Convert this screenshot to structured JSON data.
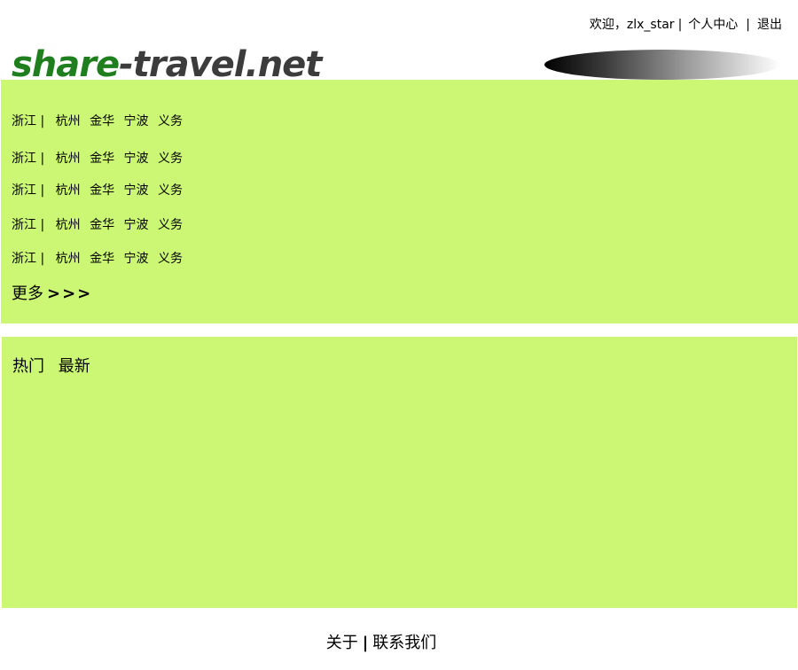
{
  "header": {
    "welcome": "欢迎，zlx_star",
    "separator": "|",
    "profile_link": "个人中心",
    "logout_link": "退出",
    "logo": {
      "part1": "share",
      "part2": "-travel.net",
      "part1_color": "#1f7f1f",
      "part2_color": "#3c3c3c"
    }
  },
  "regions": {
    "rows": [
      {
        "province": "浙江 |",
        "cities": [
          "杭州",
          "金华",
          "宁波",
          "义务"
        ]
      },
      {
        "province": "浙江 |",
        "cities": [
          "杭州",
          "金华",
          "宁波",
          "义务"
        ]
      },
      {
        "province": "浙江 |",
        "cities": [
          "杭州",
          "金华",
          "宁波",
          "义务"
        ]
      },
      {
        "province": "浙江 |",
        "cities": [
          "杭州",
          "金华",
          "宁波",
          "义务"
        ]
      },
      {
        "province": "浙江 |",
        "cities": [
          "杭州",
          "金华",
          "宁波",
          "义务"
        ]
      }
    ],
    "more_label": "更多",
    "more_arrows": ">>>"
  },
  "content": {
    "tabs": [
      "热门",
      "最新"
    ]
  },
  "footer": {
    "about": "关于",
    "separator": "|",
    "contact": "联系我们"
  },
  "colors": {
    "panel_background": "#ccf774"
  }
}
